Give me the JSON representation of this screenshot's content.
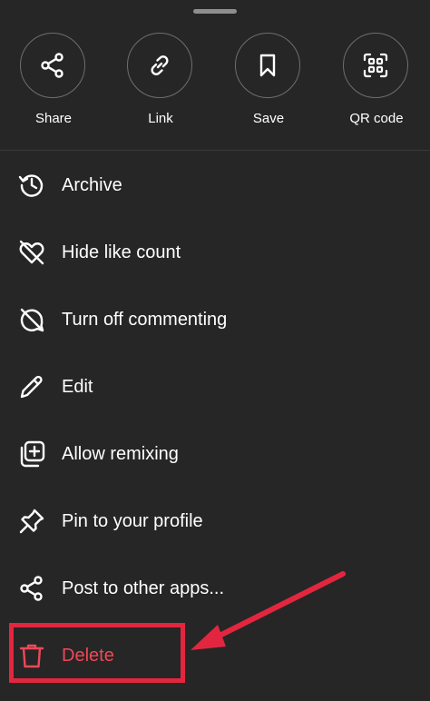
{
  "share_sheet": {
    "top_actions": [
      {
        "label": "Share",
        "icon": "share-icon"
      },
      {
        "label": "Link",
        "icon": "link-icon"
      },
      {
        "label": "Save",
        "icon": "bookmark-icon"
      },
      {
        "label": "QR code",
        "icon": "qr-code-icon"
      }
    ],
    "menu_items": [
      {
        "label": "Archive",
        "icon": "archive-history-icon"
      },
      {
        "label": "Hide like count",
        "icon": "heart-off-icon"
      },
      {
        "label": "Turn off commenting",
        "icon": "comment-off-icon"
      },
      {
        "label": "Edit",
        "icon": "pencil-icon"
      },
      {
        "label": "Allow remixing",
        "icon": "remix-icon"
      },
      {
        "label": "Pin to your profile",
        "icon": "pin-icon"
      },
      {
        "label": "Post to other apps...",
        "icon": "share-icon"
      },
      {
        "label": "Delete",
        "icon": "trash-icon"
      }
    ]
  },
  "colors": {
    "sheet_background": "#262626",
    "text": "#ffffff",
    "danger": "#ed4956",
    "annotation": "#e3263f"
  }
}
